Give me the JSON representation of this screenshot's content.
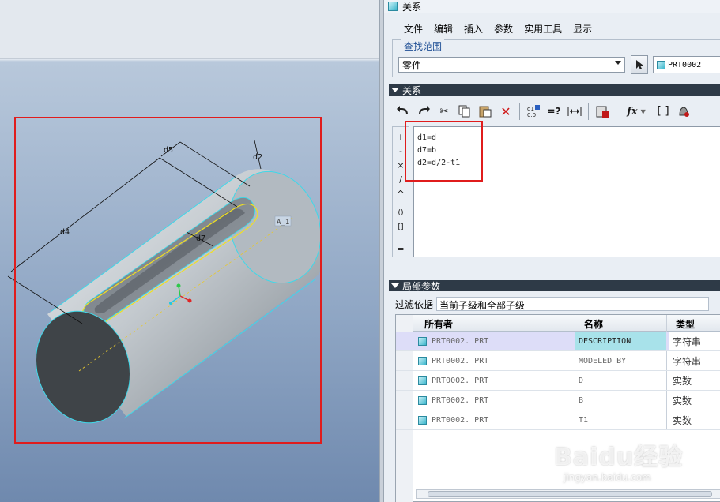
{
  "dialog": {
    "title": "关系",
    "menu": [
      "文件",
      "编辑",
      "插入",
      "参数",
      "实用工具",
      "显示"
    ],
    "scope_legend": "查找范围",
    "scope_value": "零件",
    "part_field": "PRT0002"
  },
  "relations": {
    "section_title": "关系",
    "lines": [
      "d1=d",
      "d7=b",
      "d2=d/2-t1"
    ],
    "operators": [
      "+",
      "-",
      "×",
      "/",
      "^",
      "()",
      "[]",
      "="
    ],
    "fx_label": "fx"
  },
  "local_params": {
    "section_title": "局部参数",
    "filter_label": "过滤依据",
    "filter_value": "当前子级和全部子级",
    "columns": [
      "所有者",
      "名称",
      "类型"
    ],
    "rows": [
      {
        "owner": "PRT0002. PRT",
        "name": "DESCRIPTION",
        "type": "字符串"
      },
      {
        "owner": "PRT0002. PRT",
        "name": "MODELED_BY",
        "type": "字符串"
      },
      {
        "owner": "PRT0002. PRT",
        "name": "D",
        "type": "实数"
      },
      {
        "owner": "PRT0002. PRT",
        "name": "B",
        "type": "实数"
      },
      {
        "owner": "PRT0002. PRT",
        "name": "T1",
        "type": "实数"
      }
    ]
  },
  "model": {
    "dim_labels": [
      "d5",
      "d2",
      "d4",
      "d7",
      "A_1"
    ]
  },
  "watermark": {
    "main": "Baidu经验",
    "sub": "jingyan.baidu.com"
  },
  "colors": {
    "highlight": "#e01c1c",
    "section_bar": "#2e3a47",
    "selected_cell": "#a8e2ea"
  }
}
